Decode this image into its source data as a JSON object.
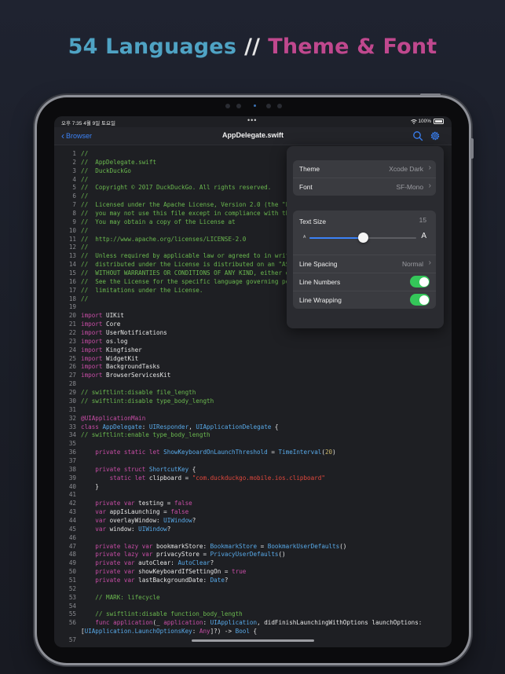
{
  "headline": {
    "languages": "54 Languages",
    "separator": "//",
    "theme_font": "Theme & Font"
  },
  "status_bar": {
    "time": "오후 7:35",
    "date": "4월 9일 토요일",
    "dots": "•••",
    "battery": "100%"
  },
  "navbar": {
    "back_label": "Browser",
    "title": "AppDelegate.swift",
    "icons": [
      "search-icon",
      "gear-icon"
    ]
  },
  "settings": {
    "theme_label": "Theme",
    "theme_value": "Xcode Dark",
    "font_label": "Font",
    "font_value": "SF-Mono",
    "text_size_label": "Text Size",
    "text_size_value": "15",
    "text_size_slider_level": 0.5,
    "small_a": "A",
    "large_a": "A",
    "line_spacing_label": "Line Spacing",
    "line_spacing_value": "Normal",
    "line_numbers_label": "Line Numbers",
    "line_numbers_on": true,
    "line_wrapping_label": "Line Wrapping",
    "line_wrapping_on": true
  },
  "colors": {
    "accent": "#3b82f6",
    "toggle_on": "#34c759",
    "comment": "#6bb94f",
    "keyword": "#c84da6",
    "type": "#58a9e8",
    "string": "#e2483c",
    "number": "#c9b56a",
    "headline_blue": "#4fa3c4",
    "headline_pink": "#c0488e"
  },
  "code_lines": [
    {
      "n": "1",
      "tokens": [
        [
          "cm",
          "//"
        ]
      ]
    },
    {
      "n": "2",
      "tokens": [
        [
          "cm",
          "//  AppDelegate.swift"
        ]
      ]
    },
    {
      "n": "3",
      "tokens": [
        [
          "cm",
          "//  DuckDuckGo"
        ]
      ]
    },
    {
      "n": "4",
      "tokens": [
        [
          "cm",
          "//"
        ]
      ]
    },
    {
      "n": "5",
      "tokens": [
        [
          "cm",
          "//  Copyright © 2017 DuckDuckGo. All rights reserved."
        ]
      ]
    },
    {
      "n": "6",
      "tokens": [
        [
          "cm",
          "//"
        ]
      ]
    },
    {
      "n": "7",
      "tokens": [
        [
          "cm",
          "//  Licensed under the Apache License, Version 2.0 (the \"L"
        ]
      ]
    },
    {
      "n": "8",
      "tokens": [
        [
          "cm",
          "//  you may not use this file except in compliance with th"
        ]
      ]
    },
    {
      "n": "9",
      "tokens": [
        [
          "cm",
          "//  You may obtain a copy of the License at"
        ]
      ]
    },
    {
      "n": "10",
      "tokens": [
        [
          "cm",
          "//"
        ]
      ]
    },
    {
      "n": "11",
      "tokens": [
        [
          "cm",
          "//  http://www.apache.org/licenses/LICENSE-2.0"
        ]
      ]
    },
    {
      "n": "12",
      "tokens": [
        [
          "cm",
          "//"
        ]
      ]
    },
    {
      "n": "13",
      "tokens": [
        [
          "cm",
          "//  Unless required by applicable law or agreed to in writ"
        ]
      ]
    },
    {
      "n": "14",
      "tokens": [
        [
          "cm",
          "//  distributed under the License is distributed on an \"AS"
        ]
      ]
    },
    {
      "n": "15",
      "tokens": [
        [
          "cm",
          "//  WITHOUT WARRANTIES OR CONDITIONS OF ANY KIND, either e"
        ]
      ]
    },
    {
      "n": "16",
      "tokens": [
        [
          "cm",
          "//  See the License for the specific language governing pe"
        ]
      ]
    },
    {
      "n": "17",
      "tokens": [
        [
          "cm",
          "//  limitations under the License."
        ]
      ]
    },
    {
      "n": "18",
      "tokens": [
        [
          "cm",
          "//"
        ]
      ]
    },
    {
      "n": "19",
      "tokens": []
    },
    {
      "n": "20",
      "tokens": [
        [
          "kw",
          "import"
        ],
        [
          "pl",
          " UIKit"
        ]
      ]
    },
    {
      "n": "21",
      "tokens": [
        [
          "kw",
          "import"
        ],
        [
          "pl",
          " Core"
        ]
      ]
    },
    {
      "n": "22",
      "tokens": [
        [
          "kw",
          "import"
        ],
        [
          "pl",
          " UserNotifications"
        ]
      ]
    },
    {
      "n": "23",
      "tokens": [
        [
          "kw",
          "import"
        ],
        [
          "pl",
          " os.log"
        ]
      ]
    },
    {
      "n": "24",
      "tokens": [
        [
          "kw",
          "import"
        ],
        [
          "pl",
          " Kingfisher"
        ]
      ]
    },
    {
      "n": "25",
      "tokens": [
        [
          "kw",
          "import"
        ],
        [
          "pl",
          " WidgetKit"
        ]
      ]
    },
    {
      "n": "26",
      "tokens": [
        [
          "kw",
          "import"
        ],
        [
          "pl",
          " BackgroundTasks"
        ]
      ]
    },
    {
      "n": "27",
      "tokens": [
        [
          "kw",
          "import"
        ],
        [
          "pl",
          " BrowserServicesKit"
        ]
      ]
    },
    {
      "n": "28",
      "tokens": []
    },
    {
      "n": "29",
      "tokens": [
        [
          "cm",
          "// swiftlint:disable file_length"
        ]
      ]
    },
    {
      "n": "30",
      "tokens": [
        [
          "cm",
          "// swiftlint:disable type_body_length"
        ]
      ]
    },
    {
      "n": "31",
      "tokens": []
    },
    {
      "n": "32",
      "tokens": [
        [
          "kw",
          "@UIApplicationMain"
        ]
      ]
    },
    {
      "n": "33",
      "tokens": [
        [
          "kw",
          "class"
        ],
        [
          "pl",
          " "
        ],
        [
          "ty",
          "AppDelegate"
        ],
        [
          "pl",
          ": "
        ],
        [
          "ty",
          "UIResponder"
        ],
        [
          "pl",
          ", "
        ],
        [
          "ty",
          "UIApplicationDelegate"
        ],
        [
          "pl",
          " {"
        ]
      ]
    },
    {
      "n": "34",
      "tokens": [
        [
          "cm",
          "// swiftlint:enable type_body_length"
        ]
      ]
    },
    {
      "n": "35",
      "tokens": []
    },
    {
      "n": "36",
      "tokens": [
        [
          "pl",
          "    "
        ],
        [
          "kw",
          "private static let"
        ],
        [
          "pl",
          " "
        ],
        [
          "ty",
          "ShowKeyboardOnLaunchThreshold"
        ],
        [
          "pl",
          " = "
        ],
        [
          "ty",
          "TimeInterval"
        ],
        [
          "pl",
          "("
        ],
        [
          "nu",
          "20"
        ],
        [
          "pl",
          ")"
        ]
      ]
    },
    {
      "n": "37",
      "tokens": []
    },
    {
      "n": "38",
      "tokens": [
        [
          "pl",
          "    "
        ],
        [
          "kw",
          "private struct"
        ],
        [
          "pl",
          " "
        ],
        [
          "ty",
          "ShortcutKey"
        ],
        [
          "pl",
          " {"
        ]
      ]
    },
    {
      "n": "39",
      "tokens": [
        [
          "pl",
          "        "
        ],
        [
          "kw",
          "static let"
        ],
        [
          "pl",
          " clipboard = "
        ],
        [
          "st",
          "\"com.duckduckgo.mobile.ios.clipboard\""
        ]
      ]
    },
    {
      "n": "40",
      "tokens": [
        [
          "pl",
          "    }"
        ]
      ]
    },
    {
      "n": "41",
      "tokens": []
    },
    {
      "n": "42",
      "tokens": [
        [
          "pl",
          "    "
        ],
        [
          "kw",
          "private var"
        ],
        [
          "pl",
          " testing = "
        ],
        [
          "kw",
          "false"
        ]
      ]
    },
    {
      "n": "43",
      "tokens": [
        [
          "pl",
          "    "
        ],
        [
          "kw",
          "var"
        ],
        [
          "pl",
          " appIsLaunching = "
        ],
        [
          "kw",
          "false"
        ]
      ]
    },
    {
      "n": "44",
      "tokens": [
        [
          "pl",
          "    "
        ],
        [
          "kw",
          "var"
        ],
        [
          "pl",
          " overlayWindow: "
        ],
        [
          "ty",
          "UIWindow"
        ],
        [
          "pl",
          "?"
        ]
      ]
    },
    {
      "n": "45",
      "tokens": [
        [
          "pl",
          "    "
        ],
        [
          "kw",
          "var"
        ],
        [
          "pl",
          " window: "
        ],
        [
          "ty",
          "UIWindow"
        ],
        [
          "pl",
          "?"
        ]
      ]
    },
    {
      "n": "46",
      "tokens": []
    },
    {
      "n": "47",
      "tokens": [
        [
          "pl",
          "    "
        ],
        [
          "kw",
          "private lazy var"
        ],
        [
          "pl",
          " bookmarkStore: "
        ],
        [
          "ty",
          "BookmarkStore"
        ],
        [
          "pl",
          " = "
        ],
        [
          "ty",
          "BookmarkUserDefaults"
        ],
        [
          "pl",
          "()"
        ]
      ]
    },
    {
      "n": "48",
      "tokens": [
        [
          "pl",
          "    "
        ],
        [
          "kw",
          "private lazy var"
        ],
        [
          "pl",
          " privacyStore = "
        ],
        [
          "ty",
          "PrivacyUserDefaults"
        ],
        [
          "pl",
          "()"
        ]
      ]
    },
    {
      "n": "49",
      "tokens": [
        [
          "pl",
          "    "
        ],
        [
          "kw",
          "private var"
        ],
        [
          "pl",
          " autoClear: "
        ],
        [
          "ty",
          "AutoClear"
        ],
        [
          "pl",
          "?"
        ]
      ]
    },
    {
      "n": "50",
      "tokens": [
        [
          "pl",
          "    "
        ],
        [
          "kw",
          "private var"
        ],
        [
          "pl",
          " showKeyboardIfSettingOn = "
        ],
        [
          "kw",
          "true"
        ]
      ]
    },
    {
      "n": "51",
      "tokens": [
        [
          "pl",
          "    "
        ],
        [
          "kw",
          "private var"
        ],
        [
          "pl",
          " lastBackgroundDate: "
        ],
        [
          "ty",
          "Date"
        ],
        [
          "pl",
          "?"
        ]
      ]
    },
    {
      "n": "52",
      "tokens": []
    },
    {
      "n": "53",
      "tokens": [
        [
          "cm",
          "    // MARK: lifecycle"
        ]
      ]
    },
    {
      "n": "54",
      "tokens": []
    },
    {
      "n": "55",
      "tokens": [
        [
          "cm",
          "    // swiftlint:disable function_body_length"
        ]
      ]
    },
    {
      "n": "56",
      "tokens": [
        [
          "pl",
          "    "
        ],
        [
          "kw",
          "func"
        ],
        [
          "pl",
          " "
        ],
        [
          "kw",
          "application"
        ],
        [
          "pl",
          "(_ "
        ],
        [
          "kw",
          "application"
        ],
        [
          "pl",
          ": "
        ],
        [
          "ty",
          "UIApplication"
        ],
        [
          "pl",
          ", didFinishLaunchingWithOptions launchOptions:"
        ]
      ]
    },
    {
      "n": "",
      "tokens": [
        [
          "pl",
          "["
        ],
        [
          "ty",
          "UIApplication.LaunchOptionsKey"
        ],
        [
          "pl",
          ": "
        ],
        [
          "kw",
          "Any"
        ],
        [
          "pl",
          "]?) -> "
        ],
        [
          "ty",
          "Bool"
        ],
        [
          "pl",
          " {"
        ]
      ]
    },
    {
      "n": "57",
      "tokens": []
    }
  ]
}
